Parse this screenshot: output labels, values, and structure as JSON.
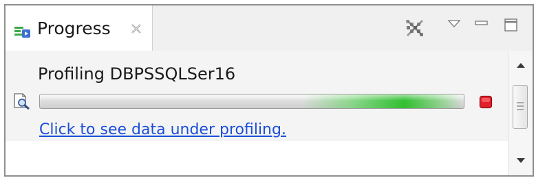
{
  "view": {
    "tab_title": "Progress",
    "icons": {
      "tab": "progress-view-icon",
      "close": "close-icon",
      "remove_all": "remove-all-finished-icon",
      "menu": "view-menu-icon",
      "minimize": "minimize-icon",
      "maximize": "maximize-icon"
    }
  },
  "job": {
    "title": "Profiling DBPSSQLSer16",
    "link_text": "Click to see data under profiling.",
    "icon": "profiling-search-icon",
    "stop_icon": "stop-icon",
    "progress_state": "indeterminate"
  },
  "scrollbar": {
    "up_icon": "scroll-up-icon",
    "down_icon": "scroll-down-icon"
  },
  "colors": {
    "link": "#1b4fd8",
    "progress_glow": "#2fbf2f",
    "stop_red": "#e0202a",
    "tab_icon_green": "#3aa84a",
    "tab_icon_blue": "#3c6fd1"
  }
}
